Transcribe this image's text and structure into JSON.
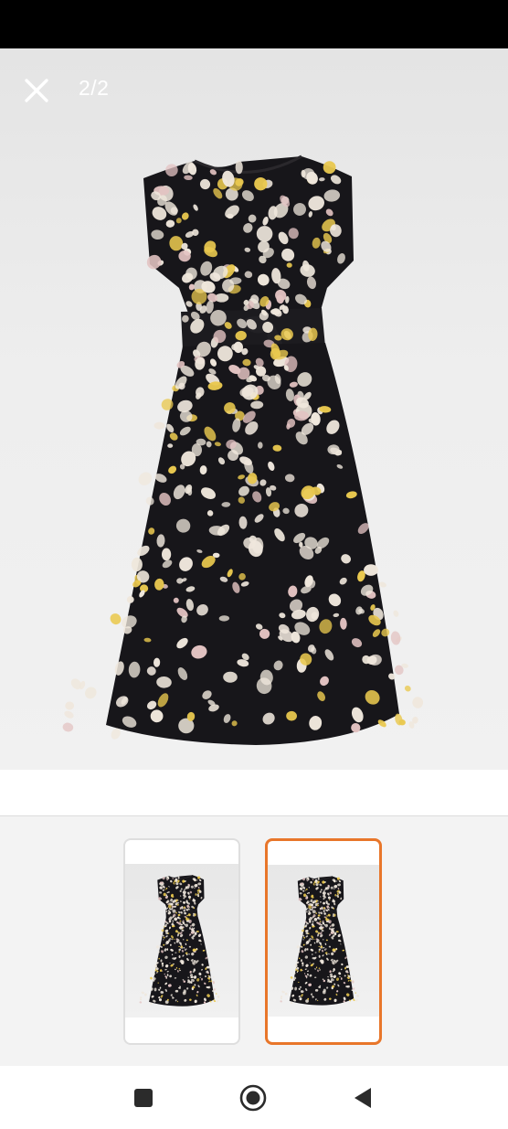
{
  "viewer": {
    "counter_text": "2/2",
    "close_icon": "close-icon",
    "image": "floral-dress-photo",
    "image_index": 2,
    "image_total": 2
  },
  "thumbnails": [
    {
      "name": "thumbnail-1",
      "selected": false
    },
    {
      "name": "thumbnail-2",
      "selected": true
    }
  ],
  "colors": {
    "accent": "#e8762a",
    "status_bar": "#000000",
    "dress_base": "#17161a",
    "print_cream": "#efe7dc",
    "print_yellow": "#e9c84f",
    "print_pink": "#e3c3c2"
  },
  "nav_bar": {
    "items": [
      "square-recents-icon",
      "circle-home-icon",
      "triangle-back-icon"
    ]
  }
}
